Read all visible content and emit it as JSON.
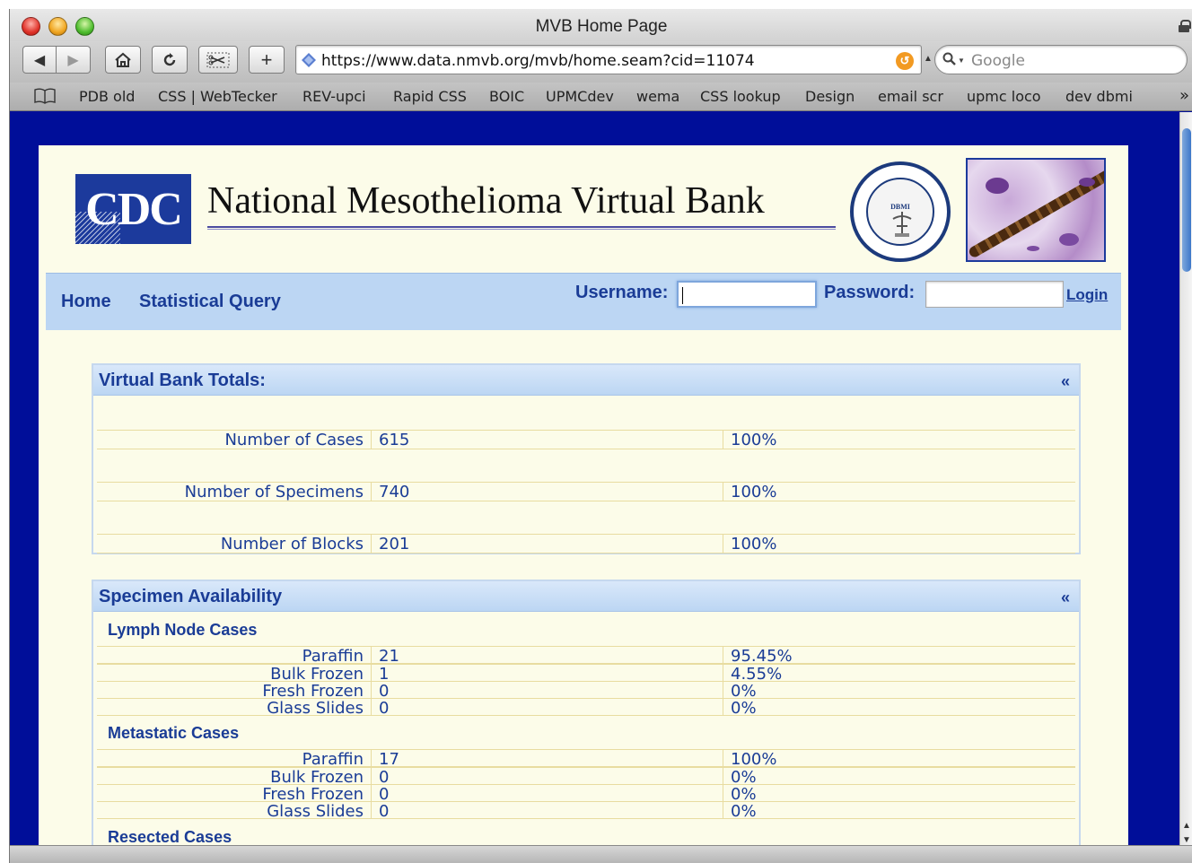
{
  "window": {
    "title": "MVB Home Page"
  },
  "toolbar": {
    "url": "https://www.data.nmvb.org/mvb/home.seam?cid=11074",
    "search_placeholder": "Google"
  },
  "bookmarks": [
    "PDB old",
    "CSS | WebTecker",
    "REV-upci",
    "Rapid CSS",
    "BOIC",
    "UPMCdev",
    "wema",
    "CSS lookup",
    "Design",
    "email scr",
    "upmc loco",
    "dev dbmi"
  ],
  "bookmarks_more": "»",
  "header": {
    "logo_text": "CDC",
    "title": "National Mesothelioma Virtual Bank",
    "seal_text": "DBMI"
  },
  "nav": {
    "home": "Home",
    "statistical_query": "Statistical Query",
    "username_label": "Username:",
    "password_label": "Password:",
    "login": "Login"
  },
  "totals": {
    "title": "Virtual Bank Totals:",
    "collapse": "«",
    "rows": [
      {
        "label": "Number of Cases",
        "value": "615",
        "percent": "100%"
      },
      {
        "label": "Number of Specimens",
        "value": "740",
        "percent": "100%"
      },
      {
        "label": "Number of Blocks",
        "value": "201",
        "percent": "100%"
      }
    ]
  },
  "availability": {
    "title": "Specimen Availability",
    "collapse": "«",
    "groups": [
      {
        "title": "Lymph Node Cases",
        "rows": [
          {
            "label": "Paraffin",
            "value": "21",
            "percent": "95.45%"
          },
          {
            "label": "Bulk Frozen",
            "value": "1",
            "percent": "4.55%"
          },
          {
            "label": "Fresh Frozen",
            "value": "0",
            "percent": "0%"
          },
          {
            "label": "Glass Slides",
            "value": "0",
            "percent": "0%"
          }
        ]
      },
      {
        "title": "Metastatic Cases",
        "rows": [
          {
            "label": "Paraffin",
            "value": "17",
            "percent": "100%"
          },
          {
            "label": "Bulk Frozen",
            "value": "0",
            "percent": "0%"
          },
          {
            "label": "Fresh Frozen",
            "value": "0",
            "percent": "0%"
          },
          {
            "label": "Glass Slides",
            "value": "0",
            "percent": "0%"
          }
        ]
      },
      {
        "title": "Resected Cases",
        "rows": []
      }
    ]
  },
  "colors": {
    "page_background": "#000e99",
    "content_background": "#fcfce9",
    "nav_background": "#bcd6f3",
    "link_text": "#1a3c96"
  }
}
